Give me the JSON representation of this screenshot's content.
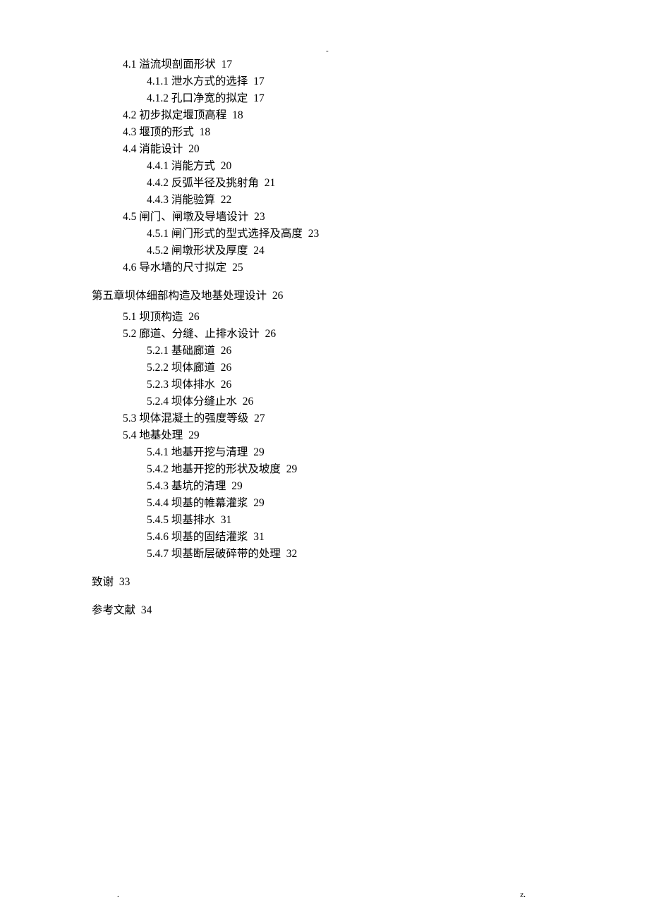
{
  "header_mark": "-",
  "footer_left": ".",
  "footer_right": "z.",
  "toc": [
    {
      "level": 2,
      "num": "4.1",
      "title": "溢流坝剖面形状",
      "page": "17"
    },
    {
      "level": 3,
      "num": "4.1.1",
      "title": "泄水方式的选择",
      "page": "17"
    },
    {
      "level": 3,
      "num": "4.1.2",
      "title": "孔口净宽的拟定",
      "page": "17"
    },
    {
      "level": 2,
      "num": "4.2",
      "title": "初步拟定堰顶高程",
      "page": "18"
    },
    {
      "level": 2,
      "num": "4.3",
      "title": "堰顶的形式",
      "page": "18"
    },
    {
      "level": 2,
      "num": "4.4",
      "title": "消能设计",
      "page": "20"
    },
    {
      "level": 3,
      "num": "4.4.1",
      "title": "消能方式",
      "page": "20"
    },
    {
      "level": 3,
      "num": "4.4.2",
      "title": "反弧半径及挑射角",
      "page": "21"
    },
    {
      "level": 3,
      "num": "4.4.3",
      "title": "消能验算",
      "page": "22"
    },
    {
      "level": 2,
      "num": "4.5",
      "title": "闸门、闸墩及导墙设计",
      "page": "23"
    },
    {
      "level": 3,
      "num": "4.5.1",
      "title": "闸门形式的型式选择及高度",
      "page": "23"
    },
    {
      "level": 3,
      "num": "4.5.2",
      "title": "闸墩形状及厚度",
      "page": "24"
    },
    {
      "level": 2,
      "num": "4.6",
      "title": "导水墙的尺寸拟定",
      "page": "25"
    },
    {
      "level": 1,
      "num": "",
      "title": "第五章坝体细部构造及地基处理设计",
      "page": "26"
    },
    {
      "level": 2,
      "num": "5.1",
      "title": "坝顶构造",
      "page": "26"
    },
    {
      "level": 2,
      "num": "5.2",
      "title": "廊道、分缝、止排水设计",
      "page": "26"
    },
    {
      "level": 3,
      "num": "5.2.1",
      "title": "基础廊道",
      "page": "26"
    },
    {
      "level": 3,
      "num": "5.2.2",
      "title": "坝体廊道",
      "page": "26"
    },
    {
      "level": 3,
      "num": "5.2.3",
      "title": "坝体排水",
      "page": "26"
    },
    {
      "level": 3,
      "num": "5.2.4",
      "title": "坝体分缝止水",
      "page": "26"
    },
    {
      "level": 2,
      "num": "5.3",
      "title": "坝体混凝土的强度等级",
      "page": "27"
    },
    {
      "level": 2,
      "num": "5.4",
      "title": "地基处理",
      "page": "29"
    },
    {
      "level": 3,
      "num": "5.4.1",
      "title": "地基开挖与清理",
      "page": "29"
    },
    {
      "level": 3,
      "num": "5.4.2",
      "title": "地基开挖的形状及坡度",
      "page": "29"
    },
    {
      "level": 3,
      "num": "5.4.3",
      "title": "基坑的清理",
      "page": "29"
    },
    {
      "level": 3,
      "num": "5.4.4",
      "title": "坝基的帷幕灌浆",
      "page": "29"
    },
    {
      "level": 3,
      "num": "5.4.5",
      "title": "坝基排水",
      "page": "31"
    },
    {
      "level": 3,
      "num": "5.4.6",
      "title": "坝基的固结灌浆",
      "page": "31"
    },
    {
      "level": 3,
      "num": "5.4.7",
      "title": "坝基断层破碎带的处理",
      "page": "32"
    },
    {
      "level": 1,
      "num": "",
      "title": "致谢",
      "page": "33"
    },
    {
      "level": 1,
      "num": "",
      "title": "参考文献",
      "page": "34"
    }
  ]
}
